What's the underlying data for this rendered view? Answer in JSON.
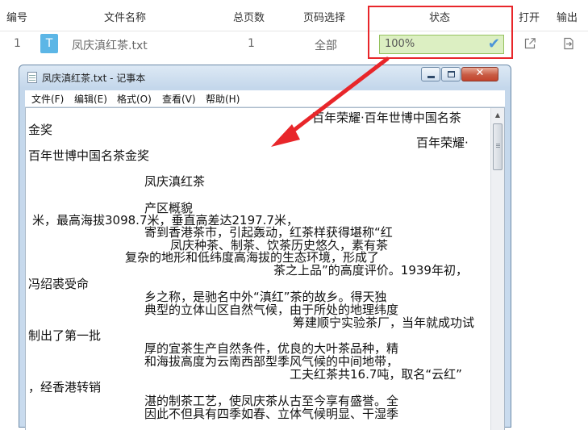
{
  "table": {
    "columns": {
      "index": "编号",
      "filename": "文件名称",
      "total_pages": "总页数",
      "page_select": "页码选择",
      "status": "状态",
      "open": "打开",
      "export": "输出"
    },
    "rows": [
      {
        "index": "1",
        "file_icon_letter": "T",
        "filename": "凤庆滇红茶.txt",
        "total_pages": "1",
        "page_select": "全部",
        "progress_text": "100%",
        "progress_value": 100
      }
    ]
  },
  "notepad": {
    "title": "凤庆滇红茶.txt - 记事本",
    "menu": [
      "文件(F)",
      "编辑(E)",
      "格式(O)",
      "查看(V)",
      "帮助(H)"
    ],
    "lines": [
      "百年荣耀·百年世博中国名茶",
      "金奖",
      "百年荣耀·",
      "百年世博中国名茶金奖",
      "凤庆滇红茶",
      "产区概貌",
      "米，最高海拔3098.7米，垂直高差达2197.7米，",
      "寄到香港茶市，引起轰动，红茶样获得堪称“红",
      "凤庆种茶、制茶、饮茶历史悠久，素有茶",
      "复杂的地形和低纬度高海拔的生态环境，形成了",
      "茶之上品”的高度评价。1939年初，",
      "冯绍裘受命",
      "乡之称，是驰名中外“滇红”茶的故乡。得天独",
      "典型的立体山区自然气候，由于所处的地理纬度",
      "筹建顺宁实验茶厂，当年就成功试",
      "制出了第一批",
      "厚的宜茶生产自然条件，优良的大叶茶品种，精",
      "和海拔高度为云南西部型季风气候的中间地带，",
      "工夫红茶共16.7吨，取名“云红”",
      "，经香港转销",
      "湛的制茶工艺，使凤庆茶从古至今享有盛誉。全",
      "因此不但具有四季如春、立体气候明显、干湿季"
    ]
  },
  "colors": {
    "highlight_border": "#e8262a",
    "arrow": "#e8262a",
    "progress_fill": "#dcefc2",
    "check": "#4b94d8"
  },
  "icons": {
    "open": "external-link-icon",
    "export": "export-file-icon",
    "status": "checkmark-icon"
  }
}
